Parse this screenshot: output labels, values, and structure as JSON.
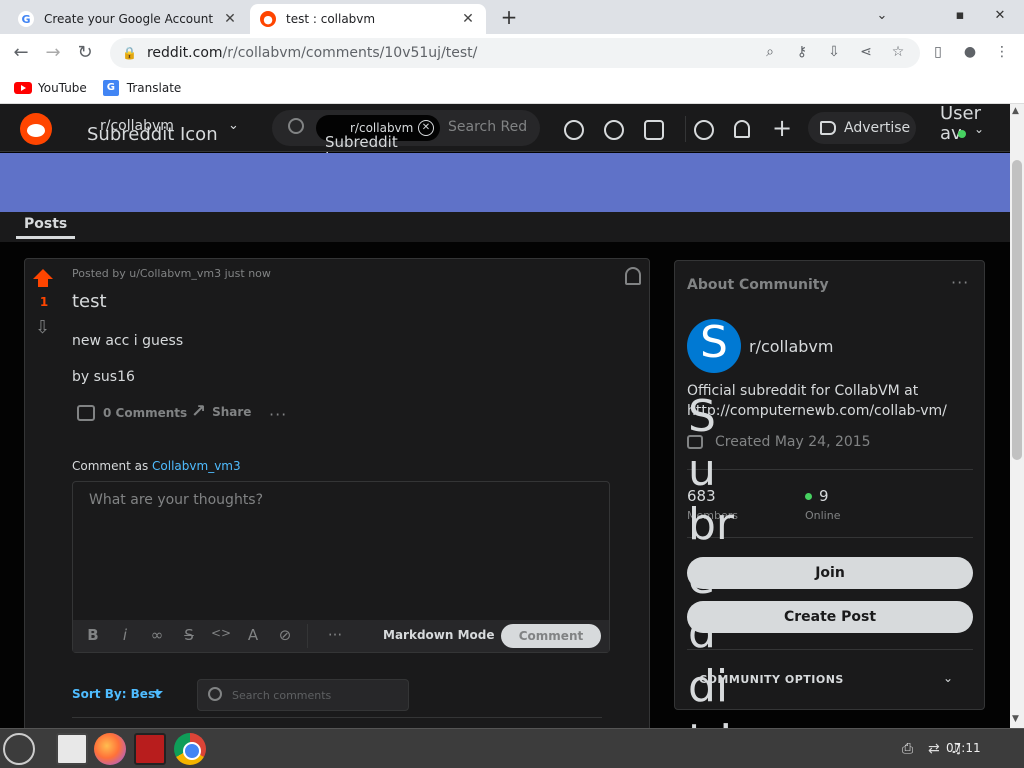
{
  "browser": {
    "tabs": [
      {
        "title": "Create your Google Account",
        "favicon": "G"
      },
      {
        "title": "test : collabvm",
        "favicon": "reddit-icon"
      }
    ],
    "new_tab": "+",
    "window_controls": [
      "⌄",
      "▪",
      "✕"
    ],
    "url_host": "reddit.com",
    "url_path": "/r/collabvm/comments/10v51uj/test/",
    "bookmarks": [
      {
        "label": "YouTube"
      },
      {
        "label": "Translate"
      }
    ]
  },
  "reddit_header": {
    "community": "r/collabvm",
    "community_icon_alt": "Subreddit Icon",
    "search_chip": "r/collabvm",
    "search_chip_icon_alt": "Subreddit Icon",
    "search_placeholder": "Search Reddit",
    "advertise": "Advertise",
    "user_alt": "User av"
  },
  "tabs": {
    "posts": "Posts"
  },
  "post": {
    "score": "1",
    "meta": "Posted by u/Collabvm_vm3 just now",
    "title": "test",
    "body": [
      "new acc i guess",
      "by sus16"
    ],
    "comments_label": "0 Comments",
    "share_label": "Share",
    "more": "···",
    "comment_as_prefix": "Comment as",
    "comment_as_user": "Collabvm_vm3",
    "comment_placeholder": "What are your thoughts?",
    "markdown_mode": "Markdown Mode",
    "comment_button": "Comment",
    "sort_label": "Sort By: Best",
    "search_comments_placeholder": "Search comments"
  },
  "about": {
    "title": "About Community",
    "more": "···",
    "avatar_letter": "S",
    "name": "r/collabvm",
    "description": "Official subreddit for CollabVM at http://computernewb.com/collab-vm/",
    "created": "Created May 24, 2015",
    "members_count": "683",
    "members_label": "Members",
    "online_count": "9",
    "online_label": "Online",
    "join": "Join",
    "create_post": "Create Post",
    "community_options": "COMMUNITY OPTIONS",
    "icon_alt_overflow": "Subreddit Icon"
  },
  "taskbar": {
    "clock": "07:11"
  },
  "colors": {
    "reddit_orange": "#ff4500",
    "banner": "#5f72c8",
    "link_blue": "#4fbcff"
  }
}
